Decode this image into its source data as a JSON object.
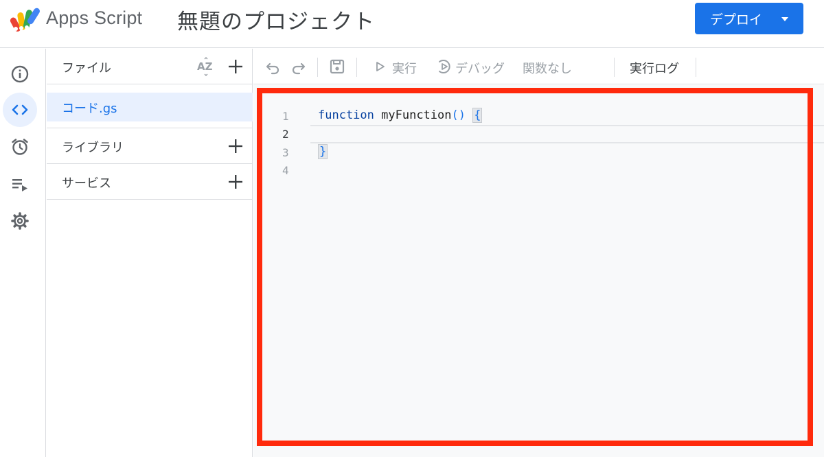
{
  "header": {
    "brand": "Apps Script",
    "project_title": "無題のプロジェクト",
    "deploy_label": "デプロイ"
  },
  "rail": {
    "items": [
      {
        "name": "overview",
        "icon": "info-icon"
      },
      {
        "name": "editor",
        "icon": "code-icon",
        "active": true
      },
      {
        "name": "triggers",
        "icon": "alarm-clock-icon"
      },
      {
        "name": "executions",
        "icon": "execution-list-icon"
      },
      {
        "name": "settings",
        "icon": "gear-icon"
      }
    ]
  },
  "files": {
    "files_label": "ファイル",
    "sort_label": "AZ",
    "file_name": "コード.gs",
    "libraries_label": "ライブラリ",
    "services_label": "サービス"
  },
  "toolbar": {
    "run_label": "実行",
    "debug_label": "デバッグ",
    "function_label": "関数なし",
    "log_label": "実行ログ"
  },
  "editor": {
    "line_numbers": [
      "1",
      "2",
      "3",
      "4"
    ],
    "keyword": "function",
    "function_name": "myFunction",
    "parens": "()",
    "open_brace": "{",
    "close_brace": "}",
    "current_line": 2
  },
  "colors": {
    "accent": "#1a73e8",
    "highlight_frame": "#ff2a0c",
    "active_bg": "#e8f0fe"
  }
}
